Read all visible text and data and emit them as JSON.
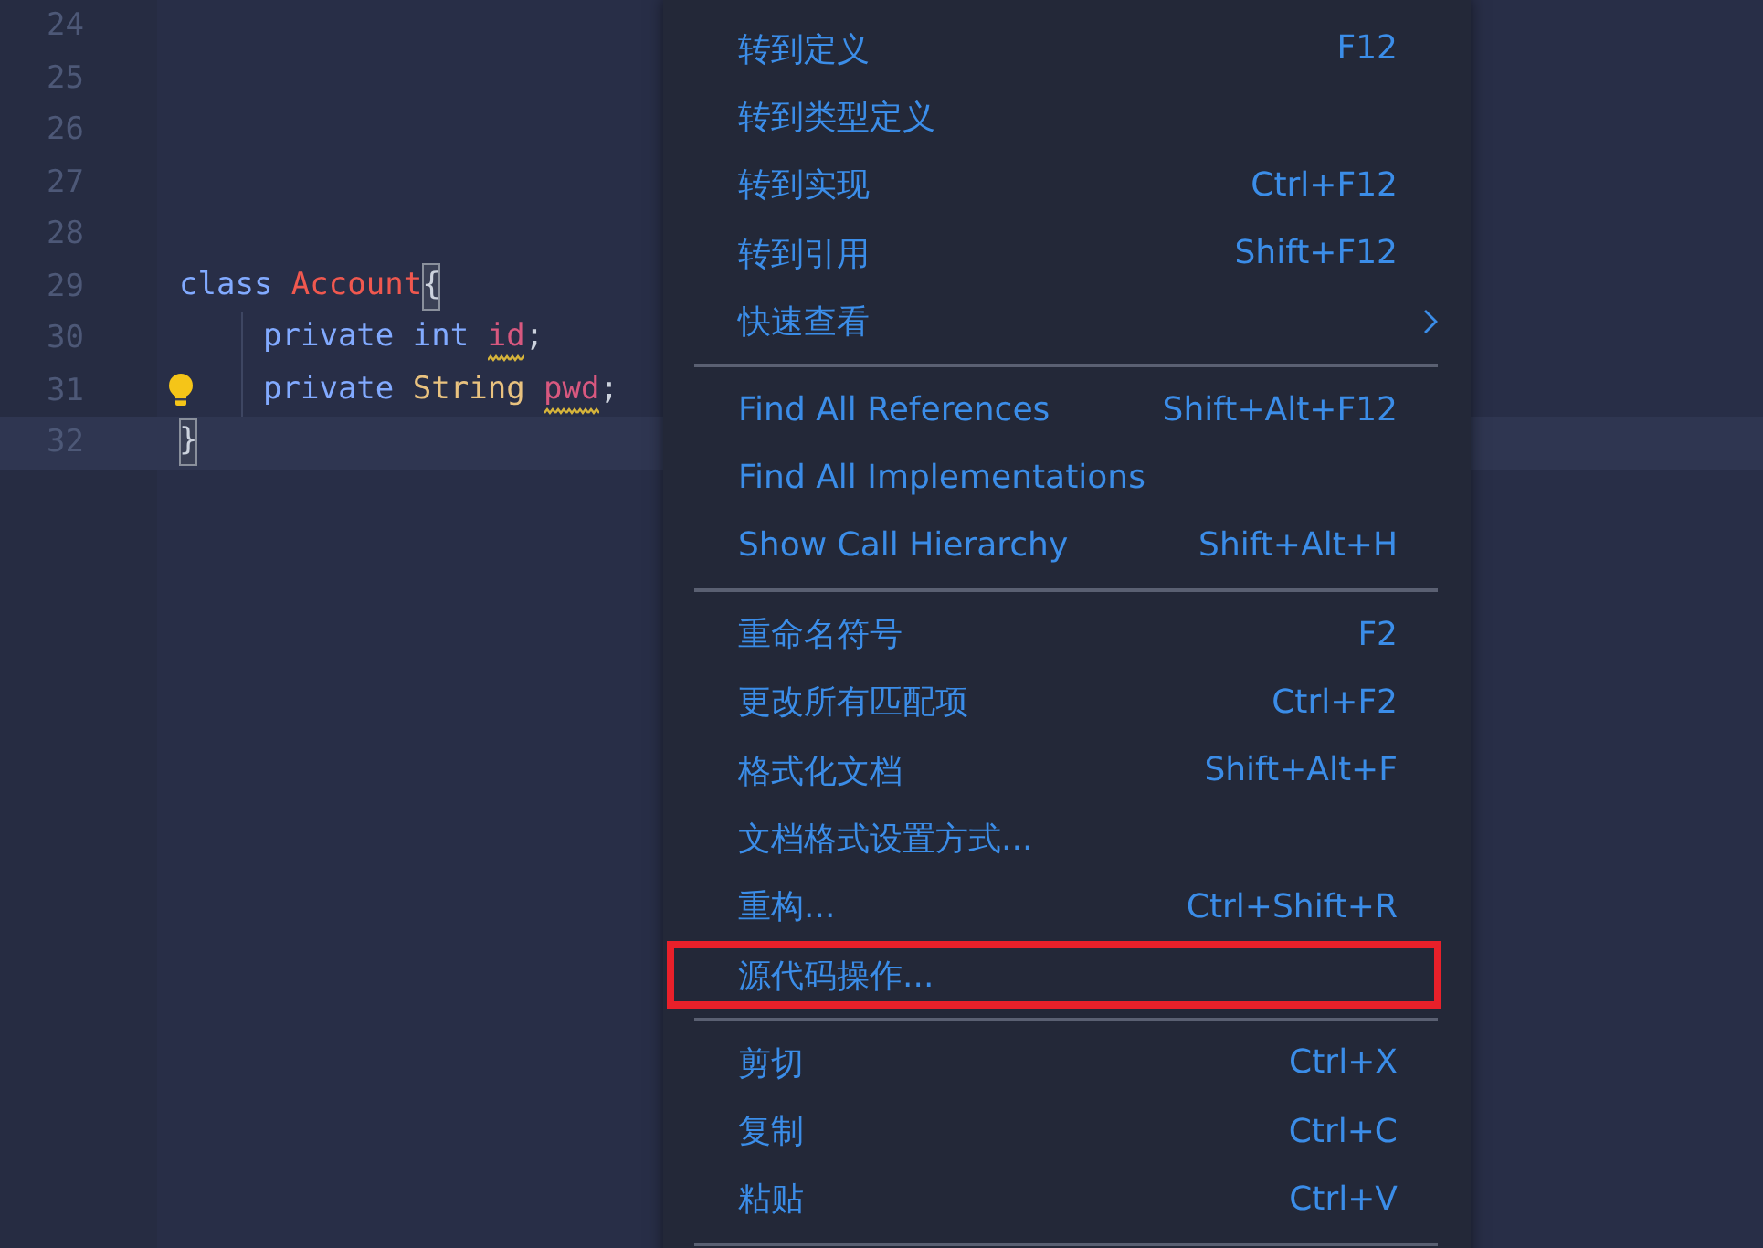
{
  "editor": {
    "lines": [
      {
        "number": "24",
        "current": false,
        "lightbulb": false,
        "indent": false
      },
      {
        "number": "25",
        "current": false,
        "lightbulb": false,
        "indent": false
      },
      {
        "number": "26",
        "current": false,
        "lightbulb": false,
        "indent": false
      },
      {
        "number": "27",
        "current": false,
        "lightbulb": false,
        "indent": false
      },
      {
        "number": "28",
        "current": false,
        "lightbulb": false,
        "indent": false
      },
      {
        "number": "29",
        "current": false,
        "lightbulb": false,
        "indent": false,
        "tokens": [
          {
            "text": "class",
            "kind": "keyword",
            "warning": false
          },
          {
            "text": "Account",
            "kind": "class",
            "warning": false
          },
          {
            "text": "{",
            "kind": "bracket",
            "warning": false
          }
        ]
      },
      {
        "number": "30",
        "current": false,
        "lightbulb": false,
        "indent": true,
        "tokens": [
          {
            "text": "private",
            "kind": "keyword",
            "warning": false
          },
          {
            "text": "int",
            "kind": "keyword",
            "warning": false
          },
          {
            "text": "id",
            "kind": "field",
            "warning": true
          },
          {
            "text": ";",
            "kind": "punct",
            "warning": false
          }
        ]
      },
      {
        "number": "31",
        "current": false,
        "lightbulb": true,
        "indent": true,
        "tokens": [
          {
            "text": "private",
            "kind": "keyword",
            "warning": false
          },
          {
            "text": "String",
            "kind": "type",
            "warning": false
          },
          {
            "text": "pwd",
            "kind": "field",
            "warning": true
          },
          {
            "text": ";",
            "kind": "punct",
            "warning": false
          }
        ]
      },
      {
        "number": "32",
        "current": true,
        "lightbulb": false,
        "indent": false,
        "tokens": [
          {
            "text": "}",
            "kind": "bracket",
            "warning": false
          }
        ]
      }
    ]
  },
  "context_menu": {
    "groups": [
      [
        {
          "label": "转到定义",
          "shortcut": "F12",
          "has_submenu": false,
          "outlined": false
        },
        {
          "label": "转到类型定义",
          "has_submenu": false,
          "outlined": false
        },
        {
          "label": "转到实现",
          "shortcut": "Ctrl+F12",
          "has_submenu": false,
          "outlined": false
        },
        {
          "label": "转到引用",
          "shortcut": "Shift+F12",
          "has_submenu": false,
          "outlined": false
        },
        {
          "label": "快速查看",
          "has_submenu": true,
          "outlined": false
        }
      ],
      [
        {
          "label": "Find All References",
          "shortcut": "Shift+Alt+F12",
          "has_submenu": false,
          "outlined": false
        },
        {
          "label": "Find All Implementations",
          "has_submenu": false,
          "outlined": false
        },
        {
          "label": "Show Call Hierarchy",
          "shortcut": "Shift+Alt+H",
          "has_submenu": false,
          "outlined": false
        }
      ],
      [
        {
          "label": "重命名符号",
          "shortcut": "F2",
          "has_submenu": false,
          "outlined": false
        },
        {
          "label": "更改所有匹配项",
          "shortcut": "Ctrl+F2",
          "has_submenu": false,
          "outlined": false
        },
        {
          "label": "格式化文档",
          "shortcut": "Shift+Alt+F",
          "has_submenu": false,
          "outlined": false
        },
        {
          "label": "文档格式设置方式...",
          "has_submenu": false,
          "outlined": false
        },
        {
          "label": "重构...",
          "shortcut": "Ctrl+Shift+R",
          "has_submenu": false,
          "outlined": false
        },
        {
          "label": "源代码操作...",
          "has_submenu": false,
          "outlined": true
        }
      ],
      [
        {
          "label": "剪切",
          "shortcut": "Ctrl+X",
          "has_submenu": false,
          "outlined": false
        },
        {
          "label": "复制",
          "shortcut": "Ctrl+C",
          "has_submenu": false,
          "outlined": false
        },
        {
          "label": "粘贴",
          "shortcut": "Ctrl+V",
          "has_submenu": false,
          "outlined": false
        }
      ]
    ]
  }
}
